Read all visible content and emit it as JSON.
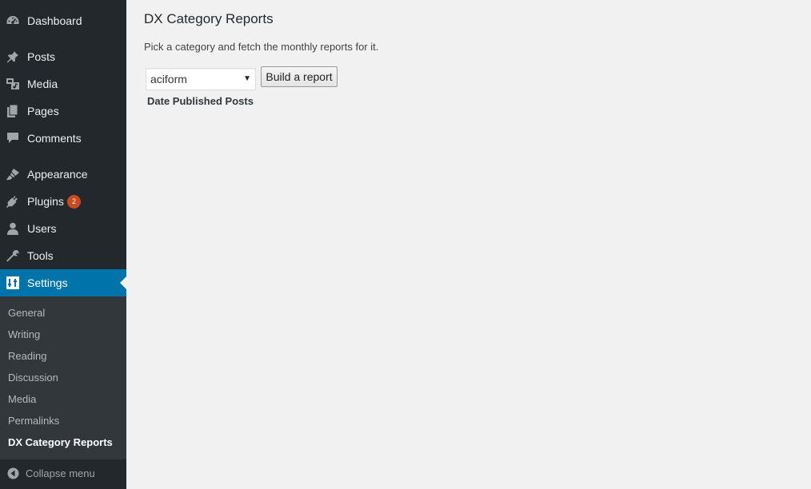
{
  "sidebar": {
    "items": [
      {
        "label": "Dashboard",
        "icon": "dashboard-icon"
      },
      {
        "label": "Posts",
        "icon": "pin-icon"
      },
      {
        "label": "Media",
        "icon": "media-icon"
      },
      {
        "label": "Pages",
        "icon": "pages-icon"
      },
      {
        "label": "Comments",
        "icon": "comment-icon"
      },
      {
        "label": "Appearance",
        "icon": "paintbrush-icon"
      },
      {
        "label": "Plugins",
        "icon": "plugin-icon",
        "badge": "2"
      },
      {
        "label": "Users",
        "icon": "user-icon"
      },
      {
        "label": "Tools",
        "icon": "wrench-icon"
      },
      {
        "label": "Settings",
        "icon": "settings-icon",
        "current": true
      }
    ],
    "submenu": [
      {
        "label": "General"
      },
      {
        "label": "Writing"
      },
      {
        "label": "Reading"
      },
      {
        "label": "Discussion"
      },
      {
        "label": "Media"
      },
      {
        "label": "Permalinks"
      },
      {
        "label": "DX Category Reports",
        "current": true
      }
    ],
    "collapse_label": "Collapse menu"
  },
  "page": {
    "title": "DX Category Reports",
    "description": "Pick a category and fetch the monthly reports for it.",
    "category_select": {
      "value": "aciform"
    },
    "build_button": "Build a report",
    "report_heading": "Date Published Posts"
  },
  "colors": {
    "sidebar_bg": "#23282d",
    "submenu_bg": "#32373c",
    "accent": "#0073aa",
    "badge": "#ca4a1f",
    "page_bg": "#f1f1f1"
  }
}
